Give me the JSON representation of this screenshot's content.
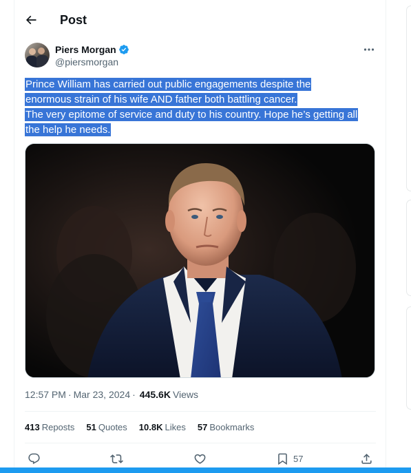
{
  "header": {
    "title": "Post",
    "back_icon": "arrow-left-icon"
  },
  "author": {
    "display_name": "Piers Morgan",
    "handle": "@piersmorgan",
    "verified": true,
    "verified_color": "#1d9bf0"
  },
  "tweet": {
    "lines": [
      "Prince William has carried out public engagements despite the",
      "enormous strain of his wife AND father both battling cancer.",
      "The very epitome of service and duty to his country. Hope he’s getting all",
      "the help he needs."
    ],
    "selection_color": "#3875d7"
  },
  "meta": {
    "time": "12:57 PM",
    "separator": "·",
    "date": "Mar 23, 2024",
    "views_count": "445.6K",
    "views_label": "Views"
  },
  "stats": [
    {
      "count": "413",
      "label": "Reposts"
    },
    {
      "count": "51",
      "label": "Quotes"
    },
    {
      "count": "10.8K",
      "label": "Likes"
    },
    {
      "count": "57",
      "label": "Bookmarks"
    }
  ],
  "actions": {
    "reply_icon": "reply-icon",
    "repost_icon": "repost-icon",
    "like_icon": "heart-icon",
    "bookmark_icon": "bookmark-icon",
    "bookmark_count": "57",
    "share_icon": "share-icon"
  },
  "colors": {
    "text_primary": "#0f1419",
    "text_secondary": "#536471",
    "accent": "#1d9bf0"
  }
}
